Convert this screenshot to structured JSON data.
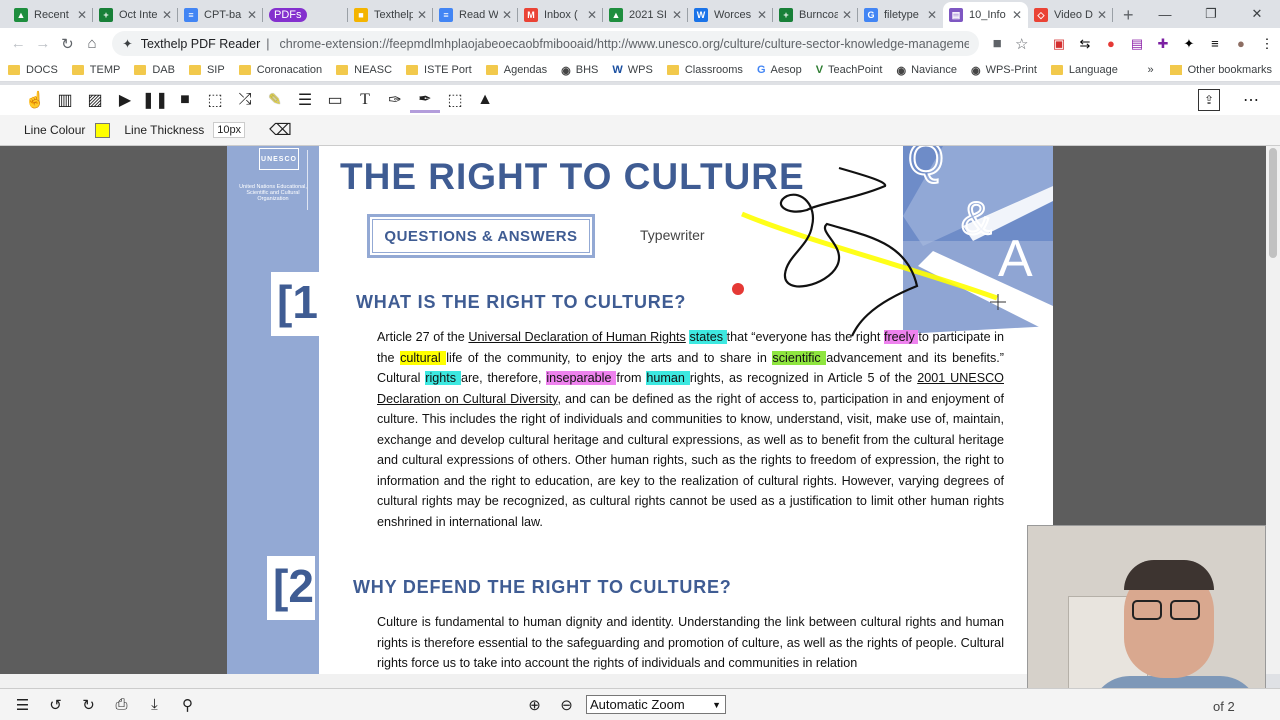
{
  "tabs": [
    {
      "label": "Recent",
      "fav_color": "#1e8e3e",
      "fav": "▲"
    },
    {
      "label": "Oct Inte",
      "fav_color": "#188038",
      "fav": "+"
    },
    {
      "label": "CPT-ba",
      "fav_color": "#4285f4",
      "fav": "≡"
    },
    {
      "label": "PDFs",
      "fav_color": "#8430ce",
      "fav": ""
    },
    {
      "label": "Texthelp",
      "fav_color": "#f4b400",
      "fav": "■"
    },
    {
      "label": "Read W",
      "fav_color": "#4285f4",
      "fav": "≡"
    },
    {
      "label": "Inbox (",
      "fav_color": "#ea4335",
      "fav": "M"
    },
    {
      "label": "2021 SI",
      "fav_color": "#1e8e3e",
      "fav": "▲"
    },
    {
      "label": "Worces",
      "fav_color": "#1a73e8",
      "fav": "W"
    },
    {
      "label": "Burncoa",
      "fav_color": "#188038",
      "fav": "+"
    },
    {
      "label": "filetype",
      "fav_color": "#4285f4",
      "fav": "G"
    },
    {
      "label": "10_Info",
      "fav_color": "#7e57c2",
      "fav": "▤"
    },
    {
      "label": "Video D",
      "fav_color": "#ea4335",
      "fav": "◇"
    }
  ],
  "address": {
    "ext_label": "Texthelp PDF Reader",
    "url": "chrome-extension://feepmdlmhplaojabeoecaobfmibooaid/http://www.unesco.org/culture/culture-sector-knowledge-management-tool..."
  },
  "bookmarks": [
    {
      "label": "DOCS",
      "type": "folder"
    },
    {
      "label": "TEMP",
      "type": "folder"
    },
    {
      "label": "DAB",
      "type": "folder"
    },
    {
      "label": "SIP",
      "type": "folder"
    },
    {
      "label": "Coronacation",
      "type": "folder"
    },
    {
      "label": "NEASC",
      "type": "folder"
    },
    {
      "label": "ISTE Port",
      "type": "folder"
    },
    {
      "label": "Agendas",
      "type": "folder"
    },
    {
      "label": "BHS",
      "type": "site"
    },
    {
      "label": "WPS",
      "type": "w"
    },
    {
      "label": "Classrooms",
      "type": "folder"
    },
    {
      "label": "Aesop",
      "type": "g"
    },
    {
      "label": "TeachPoint",
      "type": "v"
    },
    {
      "label": "Naviance",
      "type": "site"
    },
    {
      "label": "WPS-Print",
      "type": "site"
    },
    {
      "label": "Language",
      "type": "folder"
    }
  ],
  "bookmarks_more": "»",
  "other_bookmarks": "Other bookmarks",
  "drawbar": {
    "line_colour_label": "Line Colour",
    "line_thickness_label": "Line Thickness",
    "thickness_value": "10px",
    "line_color": "#ffff00"
  },
  "doc": {
    "title": "THE RIGHT TO CULTURE",
    "qa_box": "QUESTIONS & ANSWERS",
    "typewriter": "Typewriter",
    "unesco_seal": "UNESCO",
    "unesco_sub": "United Nations Educational, Scientific and Cultural Organization",
    "qa_letters": [
      "Q",
      "&",
      "A"
    ],
    "num1": "[1",
    "num2": "[2",
    "h1": "WHAT IS THE RIGHT TO CULTURE?",
    "h2": "WHY DEFEND THE RIGHT TO CULTURE?",
    "p1": {
      "a": "Article 27 of the ",
      "udhr": "Universal Declaration of Human Rights",
      "states": "states ",
      "b": "that “everyone has the right ",
      "freely": "freely ",
      "c": "to participate in the ",
      "cultural": "cultural ",
      "d": "life of the community, to enjoy the arts and to share in ",
      "scientific": "scientific ",
      "e": "advancement and its benefits.” Cultural ",
      "rights": "rights ",
      "f": "are, therefore, ",
      "inseparable": "inseparable ",
      "g": "from ",
      "human": "human ",
      "h": "rights, as recognized in Article 5 of the ",
      "decl": "2001 UNESCO Declaration on Cultural Diversity",
      "i": ", and can be defined as the right of access to, participation in and enjoyment of culture. This includes the right of individuals and communities to know, understand, visit, make use of, maintain, exchange and develop cultural heritage and cultural expressions, as well as to benefit from the cultural heritage and cultural expressions of others. Other human rights, such as the rights to freedom of expression, the right to information and the right to education, are key to the realization of cultural rights. However, varying degrees of cultural rights may be recognized, as cultural rights cannot be used as a justification to limit other human rights enshrined in international law."
    },
    "p2": "Culture is fundamental to human dignity and identity. Understanding the link between cultural rights and human rights is therefore essential to the safeguarding and promotion of culture, as well as the rights of people. Cultural rights force us to take into account the rights of individuals and communities in relation"
  },
  "zoom": "Automatic Zoom",
  "page_indicator": "of 2",
  "colors": {
    "accent": "#3f5c93",
    "strip": "#93a9d4",
    "highlight_cyan": "#3de8e0",
    "highlight_pink": "#ee82ee",
    "highlight_yellow": "#ffff00",
    "highlight_green": "#8ee53f"
  }
}
